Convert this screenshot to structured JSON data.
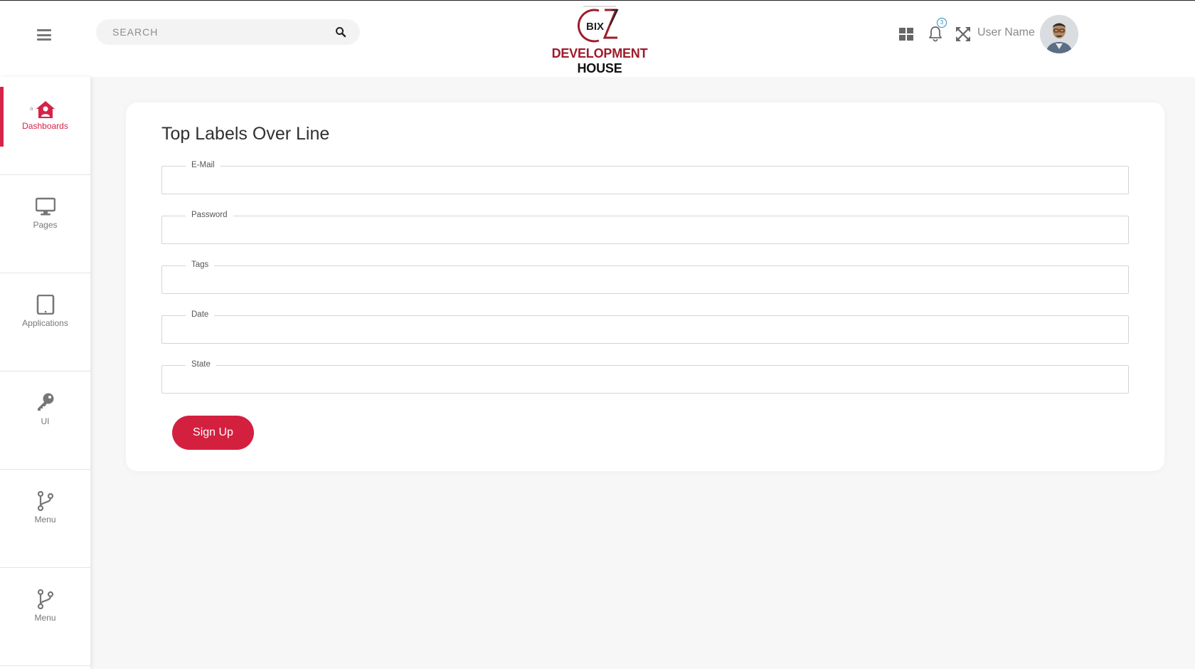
{
  "header": {
    "search_placeholder": "SEARCH",
    "logo_mark_text": "BIX",
    "logo_word_red": "DEVELOPMENT",
    "logo_word_black": "HOUSE",
    "notification_count": "3",
    "user_name": "User Name"
  },
  "sidebar": {
    "items": [
      {
        "label": "Dashboards",
        "icon": "home-icon",
        "active": true
      },
      {
        "label": "Pages",
        "icon": "monitor-icon"
      },
      {
        "label": "Applications",
        "icon": "tablet-icon"
      },
      {
        "label": "UI",
        "icon": "key-icon"
      },
      {
        "label": "Menu",
        "icon": "branch-icon"
      },
      {
        "label": "Menu",
        "icon": "branch-icon"
      }
    ],
    "small_mark": "a"
  },
  "form": {
    "title": "Top Labels Over Line",
    "fields": [
      {
        "label": "E-Mail",
        "value": ""
      },
      {
        "label": "Password",
        "value": ""
      },
      {
        "label": "Tags",
        "value": ""
      },
      {
        "label": "Date",
        "value": ""
      },
      {
        "label": "State",
        "value": ""
      }
    ],
    "submit_label": "Sign Up"
  },
  "colors": {
    "accent": "#d4203f",
    "brand_red": "#9e1c2b"
  }
}
